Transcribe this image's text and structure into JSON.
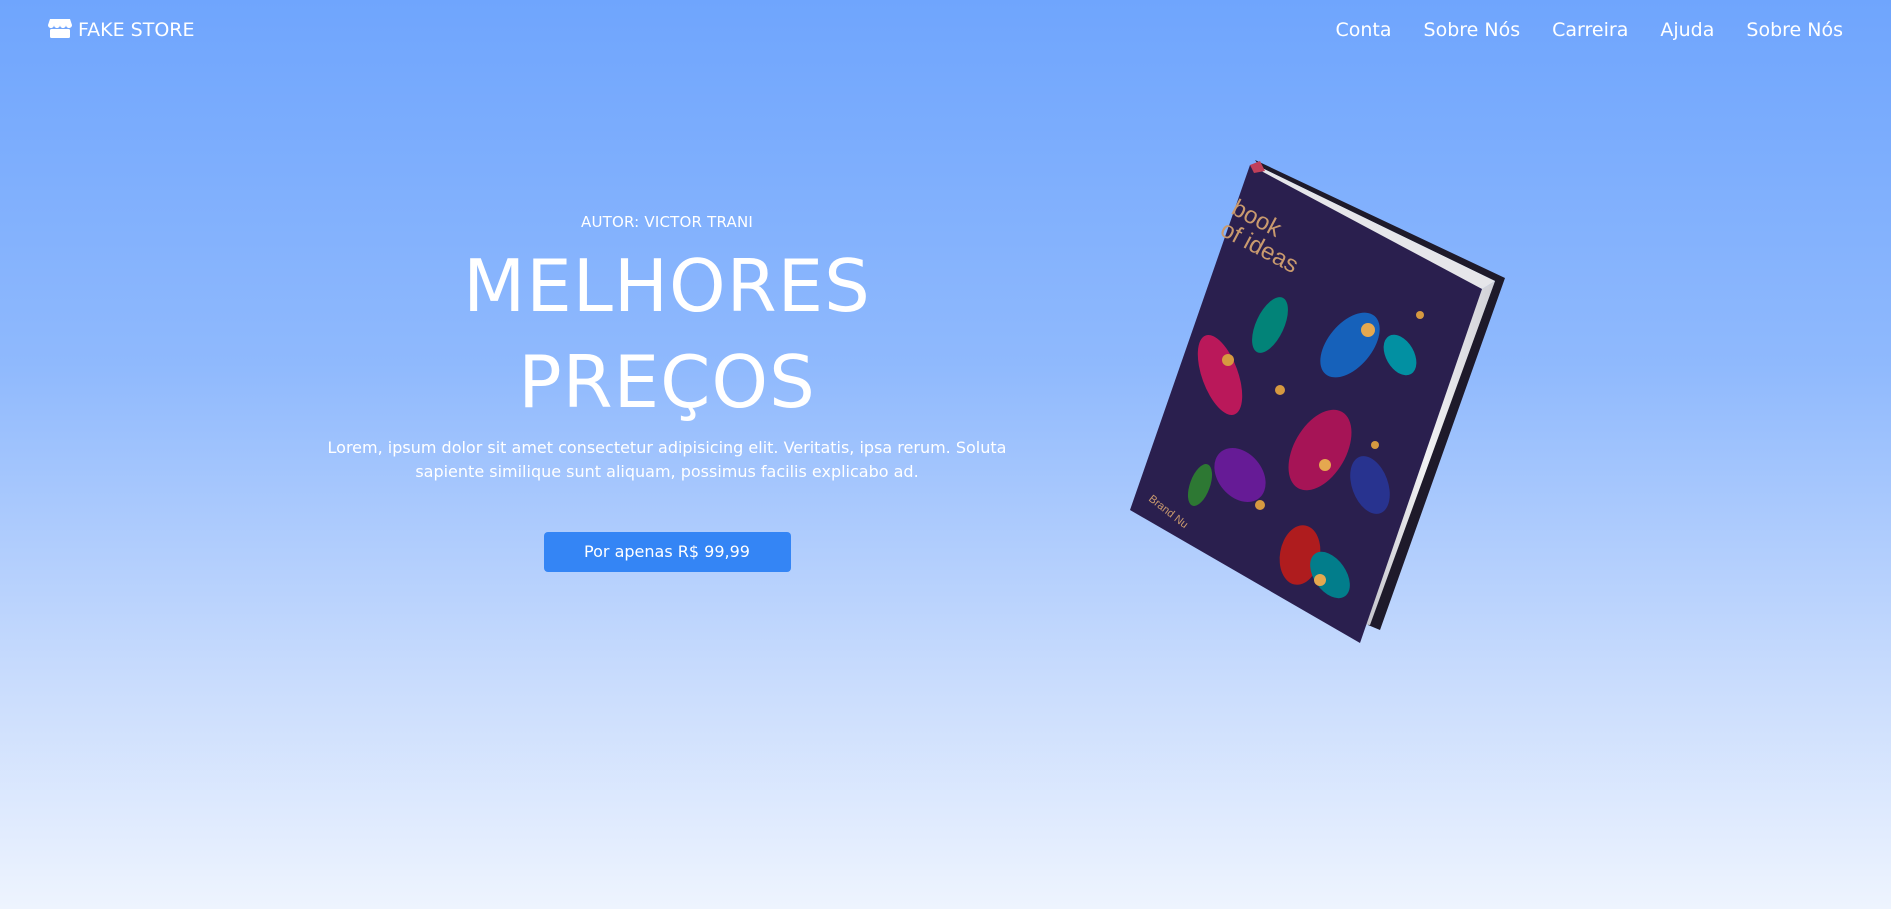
{
  "nav": {
    "brand": "FAKE STORE",
    "links": [
      "Conta",
      "Sobre Nós",
      "Carreira",
      "Ajuda",
      "Sobre Nós"
    ]
  },
  "hero": {
    "author": "AUTOR: VICTOR TRANI",
    "headline_line1": "MELHORES",
    "headline_line2": "PREÇOS",
    "description": "Lorem, ipsum dolor sit amet consectetur adipisicing elit. Veritatis, ipsa rerum. Soluta sapiente similique sunt aliquam, possimus facilis explicabo ad.",
    "cta_label": "Por apenas R$ 99,99"
  },
  "book": {
    "title_line1": "book",
    "title_line2": "of ideas",
    "publisher": "Brand Nu"
  },
  "colors": {
    "accent": "#3485f5",
    "book_cover": "#2a1f4e",
    "title_gold": "#c99a6e"
  }
}
